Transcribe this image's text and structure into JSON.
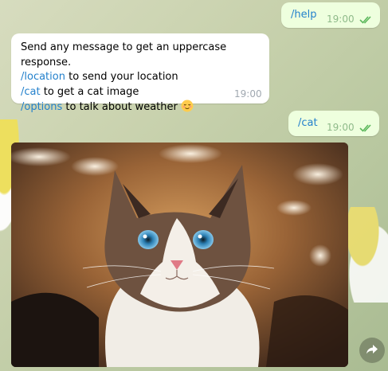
{
  "messages": {
    "help": {
      "text": "/help",
      "time": "19:00"
    },
    "info": {
      "line1": "Send any message to get an uppercase response.",
      "line2_cmd": "/location",
      "line2_rest": " to send your location",
      "line3_cmd": "/cat",
      "line3_rest": " to get a cat image",
      "line4_cmd": "/options",
      "line4_rest": " to talk about weather",
      "line4_emoji": "relieved-face-icon",
      "time": "19:00"
    },
    "cat": {
      "text": "/cat",
      "time": "19:00"
    }
  },
  "photo": {
    "subject": "cat-photo"
  },
  "colors": {
    "outgoing_bubble": "#eeffde",
    "incoming_bubble": "#ffffff",
    "link": "#2481cc",
    "read_check": "#5cb85c"
  },
  "icons": {
    "read_receipt": "double-check-icon",
    "share": "share-arrow-icon"
  }
}
